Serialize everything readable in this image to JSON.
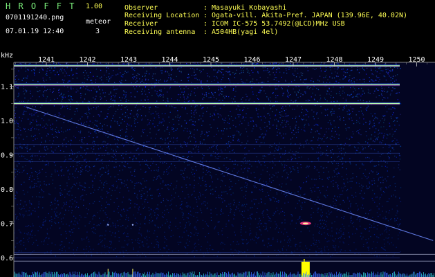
{
  "header": {
    "app_name": "H R O F F T",
    "version": "1.00",
    "filename": "0701191240.png",
    "mode_label": "meteor",
    "timestamp": "07.01.19 12:40",
    "meteor_count": "3",
    "info_labels": [
      "Observer",
      "Receiving Location",
      "Receiver",
      "Receiving antenna"
    ],
    "info_values": [
      ": Masayuki Kobayashi",
      ": Ogata-vill. Akita-Pref. JAPAN (139.96E, 40.02N)",
      ": ICOM IC-575 53.7492(@LCD)MHz USB",
      ": A504HB(yagi 4el)"
    ]
  },
  "colors": {
    "background": "#000000",
    "text_green": "#7cf07c",
    "text_yellow": "#ffff55",
    "text_white": "#ffffff",
    "noise_base": "#0a0f58",
    "signal": "#ffff00"
  },
  "chart_data": {
    "type": "heatmap",
    "y_unit_label": "kHz",
    "time_ticks": [
      "1241",
      "1242",
      "1243",
      "1244",
      "1245",
      "1246",
      "1247",
      "1248",
      "1249",
      "1250"
    ],
    "freq_ticks": [
      "1.1",
      "1.0",
      "0.9",
      "0.8",
      "0.7",
      "0.6"
    ],
    "freq_range_khz": [
      0.58,
      1.17
    ],
    "time_range_min": [
      1240.2,
      1250.5
    ],
    "carrier_lines_khz": [
      1.16,
      1.105,
      1.05
    ],
    "drifting_signal": {
      "start": [
        1240.5,
        1.04
      ],
      "end": [
        1250.4,
        0.65
      ]
    },
    "meteor_echoes": [
      {
        "time": 1242.5,
        "freq": 0.7,
        "strength": 0.3
      },
      {
        "time": 1243.1,
        "freq": 0.7,
        "strength": 0.3
      },
      {
        "time": 1247.3,
        "freq": 0.7,
        "strength": 1.0
      }
    ]
  }
}
